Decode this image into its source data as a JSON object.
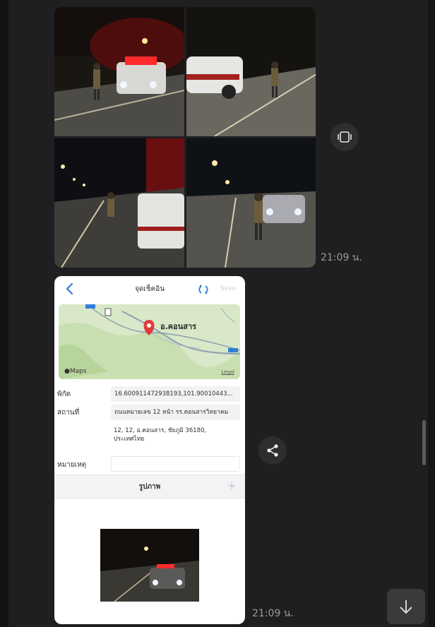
{
  "messages": {
    "album_timestamp": "21:09 น.",
    "screenshot_timestamp": "21:09 น."
  },
  "checkin": {
    "title": "จุดเช็คอิน",
    "save_label": "Save",
    "map": {
      "place_label": "อ.คอนสาร",
      "brand": "Maps",
      "legal": "Legal",
      "road_marker_top": "MPB",
      "road_marker_right": "RN"
    },
    "coord_label": "พิกัด",
    "coord_value": "16.600911472938193,101.90010443...",
    "place_label": "สถานที่",
    "place_value": "ถนนหมายเลข 12 หน้า รร.คอนสารวิทยาคม",
    "address_line1": "12, 12, อ.คอนสาร, ชัยภูมิ 36180,",
    "address_line2": "ประเทศไทย",
    "note_label": "หมายเหตุ",
    "note_value": "",
    "photo_section": "รูปภาพ",
    "add_symbol": "+"
  },
  "icons": {
    "vibrate": "vibrate-icon",
    "share": "share-icon",
    "down": "arrow-down-icon"
  },
  "colors": {
    "background": "#1f1f21",
    "card": "#ffffff",
    "accent_blue": "#2f7fd6",
    "pin_red": "#e03b3b"
  }
}
